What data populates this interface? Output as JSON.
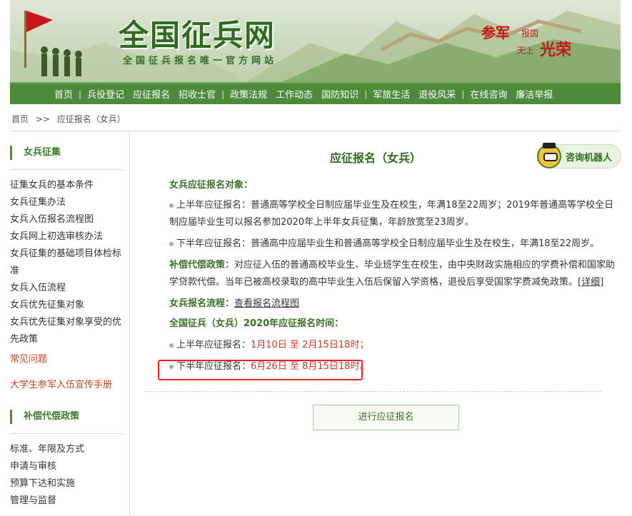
{
  "header": {
    "title": "全国征兵网",
    "subtitle": "全国征兵报名唯一官方网站",
    "slogan": {
      "part1": "参军",
      "part2": "报国",
      "part3": "无上",
      "part4": "光荣"
    }
  },
  "nav": {
    "items": [
      "首页",
      "兵役登记",
      "应征报名",
      "招收士官",
      "政策法规",
      "工作动态",
      "国防知识",
      "军旅生活",
      "退役风采",
      "在线咨询",
      "廉洁举报"
    ],
    "separator": "|"
  },
  "breadcrumb": {
    "home": "首页",
    "sep": ">>",
    "current": "应征报名（女兵）"
  },
  "sidebar": {
    "section1_title": "女兵征集",
    "section1_links": [
      "征集女兵的基本条件",
      "女兵征集办法",
      "女兵入伍报名流程图",
      "女兵网上初选审核办法",
      "女兵征集的基础项目体检标准",
      "女兵入伍流程",
      "女兵优先征集对象",
      "女兵优先征集对象享受的优先政策"
    ],
    "faq": "常见问题",
    "handbook": "大学生参军入伍宣传手册",
    "section2_title": "补偿代偿政策",
    "section2_links": [
      "标准、年限及方式",
      "申请与审核",
      "预算下达和实施",
      "管理与监督"
    ]
  },
  "main": {
    "title": "应征报名（女兵）",
    "robot_label": "咨询机器人",
    "objects_heading": "女兵应征报名对象：",
    "first_half": "上半年应征报名：普通高等学校全日制应届毕业生及在校生，年满18至22周岁；2019年普通高等学校全日制应届毕业生可以报名参加2020年上半年女兵征集，年龄放宽至23周岁。",
    "second_half": "下半年应征报名：普通高中应届毕业生和普通高等学校全日制应届毕业生及在校生，年满18至22周岁。",
    "compensation_label": "补偿代偿政策：",
    "compensation_text": "对应征入伍的普通高校毕业生、毕业班学生在校生，由中央财政实施相应的学费补偿和国家助学贷款代偿。当年已被高校录取的高中毕业生入伍后保留入学资格，退役后享受国家学费减免政策。",
    "detail_link": "[详细]",
    "process_label": "女兵报名流程：",
    "process_link": "查看报名流程图",
    "time_heading": "全国征兵（女兵）2020年应征报名时间：",
    "time_first_label": "上半年应征报名：",
    "time_first_value": "1月10日 至 2月15日18时；",
    "time_second_label": "下半年应征报名：",
    "time_second_value": "6月26日 至 8月15日18时。",
    "apply_button": "进行应征报名"
  },
  "colors": {
    "brand_green": "#4d8a3a",
    "title_green": "#2f6b1f",
    "highlight_red": "#e02222",
    "date_red": "#c0392b"
  }
}
